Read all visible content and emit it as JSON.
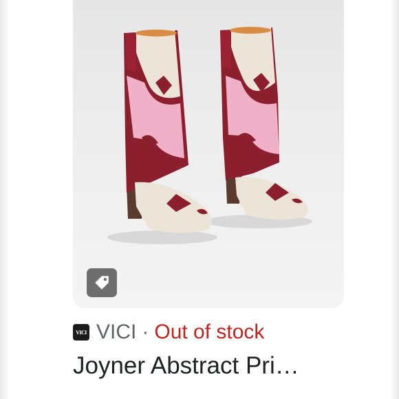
{
  "result": {
    "image_alt": "Joyner Abstract Print cowboy boots",
    "tag_icon": "tag-icon",
    "favicon_text": "VICI",
    "source": "VICI",
    "separator": "·",
    "availability": "Out of stock",
    "title": "Joyner Abstract Pri…"
  },
  "colors": {
    "availability": "#c5221f",
    "source": "#5f6368",
    "title": "#202124",
    "card_bg": "#ececec",
    "tag_button": "#6e6e6e"
  }
}
